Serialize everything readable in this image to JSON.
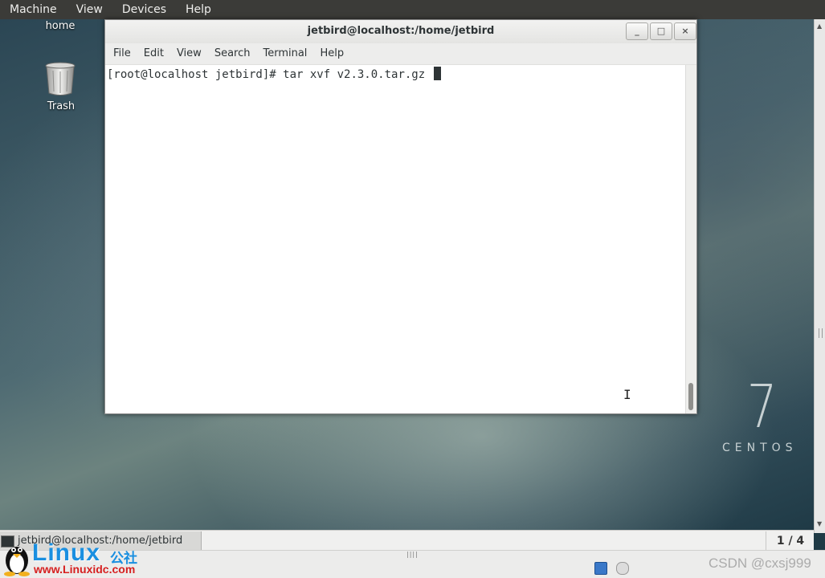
{
  "vm_menu": [
    "Machine",
    "View",
    "Devices",
    "Help"
  ],
  "desktop": {
    "home_label": "home",
    "trash_label": "Trash",
    "brand_number": "7",
    "brand_word": "CENTOS"
  },
  "terminal": {
    "title": "jetbird@localhost:/home/jetbird",
    "buttons": {
      "minimize": "_",
      "maximize": "□",
      "close": "×"
    },
    "menu": [
      "File",
      "Edit",
      "View",
      "Search",
      "Terminal",
      "Help"
    ],
    "prompt": "[root@localhost jetbird]# ",
    "command": "tar xvf v2.3.0.tar.gz "
  },
  "taskbar": {
    "window_label": "jetbird@localhost:/home/jetbird",
    "workspace": "1 / 4"
  },
  "watermarks": {
    "linux_word": "Linux",
    "linux_cn": "公社",
    "linux_url": "www.Linuxidc.com",
    "csdn": "CSDN @cxsj999"
  }
}
